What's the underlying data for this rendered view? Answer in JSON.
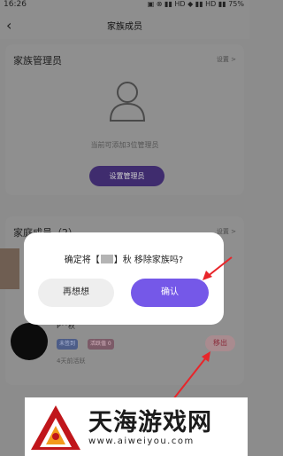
{
  "status_bar": {
    "time": "16:26",
    "right": "▣ ⊗ ▮▮ HD ◆ ▮▮ HD ▮▮ 75%"
  },
  "nav": {
    "title": "家族成员",
    "back_icon": "chevron-left-icon"
  },
  "admin_section": {
    "title": "家族管理员",
    "action": "设置 >",
    "hint": "当前可添加3位管理员",
    "button_label": "设置管理员"
  },
  "members_section": {
    "title": "家庭成员（2）",
    "action": "设置 >",
    "member": {
      "name": "P°°秋",
      "tags": [
        "未签到",
        "活跃值 0"
      ],
      "last_active": "4天前活跃",
      "remove_label": "移出"
    }
  },
  "dialog": {
    "message_prefix": "确定将【",
    "message_suffix": "】秋 移除家族吗?",
    "cancel_label": "再想想",
    "confirm_label": "确认"
  },
  "watermark": {
    "title": "天海游戏网",
    "url": "www.aiweiyou.com"
  },
  "colors": {
    "accent": "#7558e8",
    "arrow": "#e8252a",
    "remove": "#8a2b3a"
  }
}
